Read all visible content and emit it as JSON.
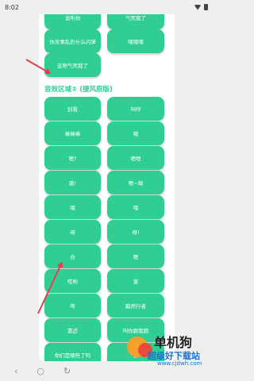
{
  "status_bar": {
    "time": "8:02"
  },
  "buttons_top": [
    {
      "left": "说听你",
      "right": "气死我了"
    },
    {
      "left": "你没事乱扔什么闪弹",
      "right": "嘿嘿嘿"
    },
    {
      "left": "这帮气死我了",
      "right": null
    }
  ],
  "section_title": "音效区域② (捷风原版)",
  "buttons_main": [
    {
      "left": "别看",
      "right": "叫哼"
    },
    {
      "left": "棒棒棒",
      "right": "哦"
    },
    {
      "left": "嗯?",
      "right": "嗯嗯"
    },
    {
      "left": "跳!",
      "right": "嗯~呦"
    },
    {
      "left": "嘿",
      "right": "嘿"
    },
    {
      "left": "呀",
      "right": "呀!"
    },
    {
      "left": "合",
      "right": "嗯"
    },
    {
      "left": "哎哟",
      "right": "害"
    },
    {
      "left": "呵",
      "right": "黯然行者"
    },
    {
      "left": "靠近",
      "right": "叫你跟我跑"
    },
    {
      "left": "你们是哪些了吗",
      "right": "好"
    }
  ],
  "nav": {
    "back": "‹",
    "home": "○",
    "recent": "↻"
  },
  "watermark": {
    "title": "单机狗",
    "subtitle": "超级好下载站",
    "url": "www.cjdwh.com"
  },
  "colors": {
    "button": "#2fcf94",
    "arrow": "#e63e4e"
  }
}
